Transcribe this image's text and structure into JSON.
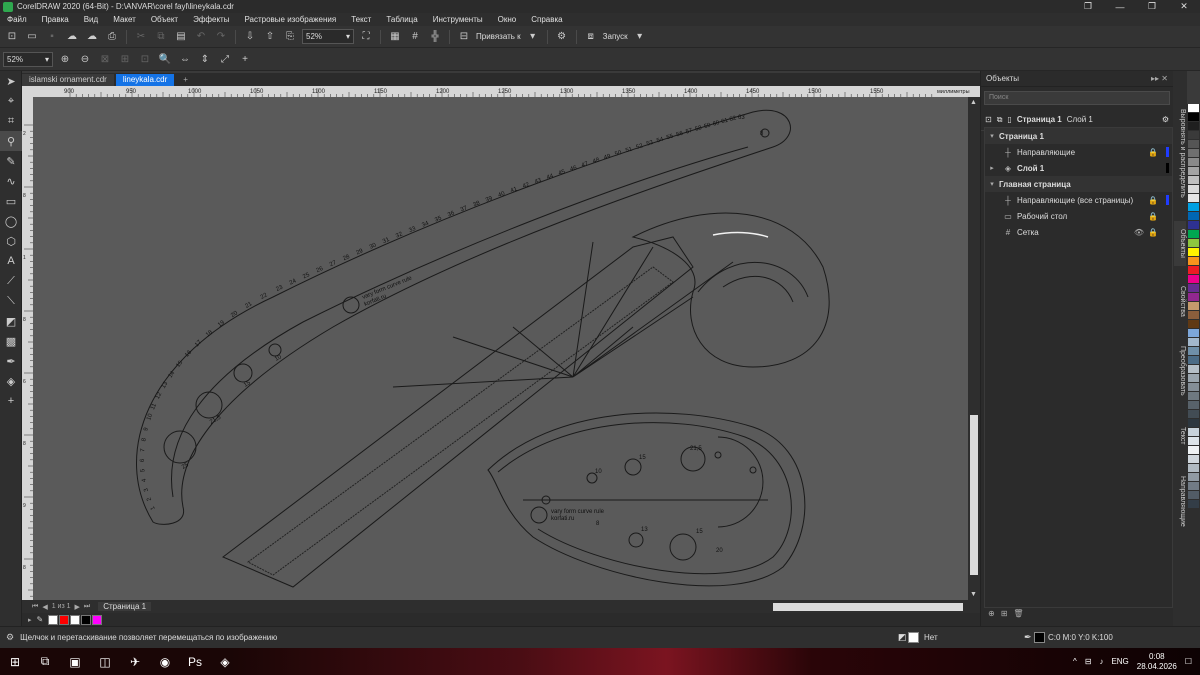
{
  "app": {
    "title": "CorelDRAW 2020 (64-Bit) - D:\\ANVAR\\corel fayl\\lineykala.cdr",
    "window_buttons": [
      "❐",
      "—",
      "❐",
      "✕"
    ]
  },
  "menu": [
    "Файл",
    "Правка",
    "Вид",
    "Макет",
    "Объект",
    "Эффекты",
    "Растровые изображения",
    "Текст",
    "Таблица",
    "Инструменты",
    "Окно",
    "Справка"
  ],
  "toolbar": {
    "zoom_value": "52%",
    "snap_label": "Привязать к",
    "launch_label": "Запуск"
  },
  "propertybar": {
    "zoom_value": "52%"
  },
  "tabs": [
    {
      "label": "islamski ornament.cdr",
      "active": false
    },
    {
      "label": "lineykala.cdr",
      "active": true
    }
  ],
  "ruler": {
    "h_ticks": [
      "900",
      "950",
      "1000",
      "1050",
      "1100",
      "1150",
      "1200",
      "1250",
      "1300",
      "1350",
      "1400",
      "1450",
      "1500",
      "1550"
    ],
    "h_units": "миллиметры",
    "v_ticks": [
      "2",
      "8",
      "1",
      "8",
      "6",
      "8",
      "9",
      "8",
      "1"
    ]
  },
  "pagebar": {
    "page_count": "1 из 1",
    "page_label": "Страница 1"
  },
  "canvas_text": {
    "brand_line1": "vary form curve rule",
    "brand_line2": "korfati.ru",
    "ruler_top_numbers": [
      "1",
      "2",
      "3",
      "4",
      "5",
      "6",
      "7",
      "8",
      "9",
      "10",
      "11",
      "12",
      "13",
      "14",
      "15",
      "16",
      "17",
      "18",
      "19",
      "20",
      "21",
      "22",
      "23",
      "24",
      "25",
      "26",
      "27",
      "28",
      "29",
      "30",
      "31",
      "32",
      "33",
      "34",
      "35",
      "36",
      "37",
      "38",
      "39",
      "40",
      "41",
      "42",
      "43",
      "44",
      "45",
      "46",
      "47",
      "48",
      "49",
      "50",
      "51",
      "52",
      "53",
      "54",
      "55",
      "56",
      "57",
      "58",
      "59",
      "60",
      "61",
      "62",
      "63"
    ],
    "hole_labels_left": [
      "25",
      "21,5",
      "15",
      "10",
      "8"
    ],
    "hole_labels_right": [
      "10",
      "15",
      "21,5",
      "8",
      "13",
      "15",
      "20"
    ]
  },
  "objects_panel": {
    "title": "Объекты",
    "search_placeholder": "Поиск",
    "page_label": "Страница 1",
    "layer_label": "Слой 1",
    "tree": [
      {
        "label": "Страница 1",
        "type": "head"
      },
      {
        "label": "Направляющие",
        "type": "item",
        "lock": true,
        "color": "#1f3cff"
      },
      {
        "label": "Слой 1",
        "type": "item-bold",
        "lock": false,
        "color": ""
      },
      {
        "label": "Главная страница",
        "type": "head"
      },
      {
        "label": "Направляющие (все страницы)",
        "type": "item",
        "lock": true,
        "color": "#1f3cff"
      },
      {
        "label": "Рабочий стол",
        "type": "item",
        "lock": true,
        "color": ""
      },
      {
        "label": "Сетка",
        "type": "item",
        "lock": true,
        "color": ""
      }
    ]
  },
  "side_tabs": [
    "Выровнять и распределить",
    "Объекты",
    "Свойства",
    "Преобразовать",
    "Текст",
    "Направляющие"
  ],
  "status": {
    "hint": "Щелчок и перетаскивание позволяет перемещаться по изображению",
    "fill_label": "Нет",
    "color_info": "C:0 M:0 Y:0 K:100"
  },
  "taskbar": {
    "lang": "ENG",
    "time": "0:08",
    "date": "28.04.2026"
  },
  "palette_colors": [
    "#ffffff",
    "#000000",
    "#1f1f1f",
    "#3a3a3a",
    "#555555",
    "#6f6f6f",
    "#8a8a8a",
    "#a4a4a4",
    "#bfbfbf",
    "#d9d9d9",
    "#e5e5e5",
    "#00a0e3",
    "#0066b3",
    "#2e3192",
    "#00a651",
    "#8dc63f",
    "#fff200",
    "#f7941d",
    "#ed1c24",
    "#ec008c",
    "#662d91",
    "#92278f",
    "#c49a6c",
    "#8b5e3c",
    "#603913",
    "#7da7d9",
    "#a3b8cc",
    "#6f8fa8",
    "#4b6b85",
    "#b5bfc7",
    "#9aa5ae",
    "#848e97",
    "#6e7880",
    "#58626a",
    "#424c54",
    "#2c363e",
    "#c7d2da",
    "#dde4e9",
    "#eff2f4",
    "#d0d7dd",
    "#b0bac2",
    "#909aa3",
    "#717b85",
    "#525c66",
    "#333d47"
  ]
}
